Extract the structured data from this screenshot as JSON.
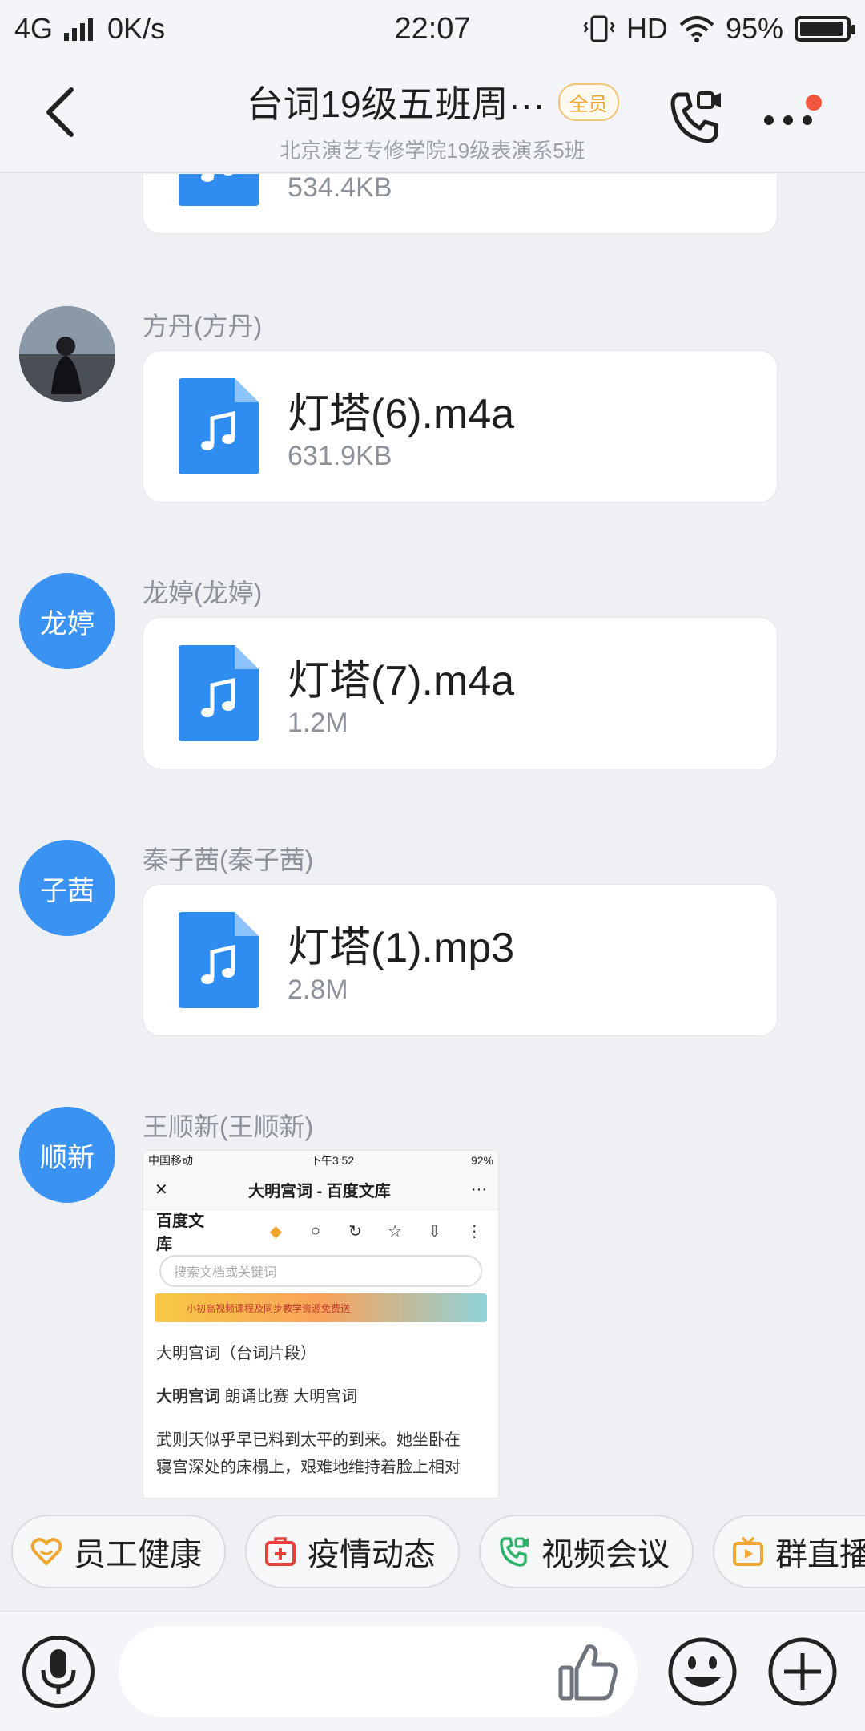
{
  "status_bar": {
    "network": "4G",
    "speed": "0K/s",
    "time": "22:07",
    "hd": "HD",
    "battery_text": "95%",
    "battery_level": 0.95
  },
  "header": {
    "title": "台词19级五班周···",
    "badge": "全员",
    "subtitle": "北京演艺专修学院19级表演系5班"
  },
  "messages": [
    {
      "file_size": "534.4KB"
    },
    {
      "sender": "方丹(方丹)",
      "file_name": "灯塔(6).m4a",
      "file_size": "631.9KB"
    },
    {
      "sender": "龙婷(龙婷)",
      "avatar_text": "龙婷",
      "file_name": "灯塔(7).m4a",
      "file_size": "1.2M"
    },
    {
      "sender": "秦子茜(秦子茜)",
      "avatar_text": "子茜",
      "file_name": "灯塔(1).mp3",
      "file_size": "2.8M"
    },
    {
      "sender": "王顺新(王顺新)",
      "avatar_text": "顺新"
    }
  ],
  "screenshot": {
    "carrier": "中国移动",
    "time": "下午3:52",
    "battery": "92%",
    "title": "大明宫词 - 百度文库",
    "brand": "百度文库",
    "search_placeholder": "搜索文档或关键词",
    "banner": "小初高视频课程及同步教学资源免费送",
    "line1": "大明宫词（台词片段）",
    "line2_bold": "大明宫词",
    "line2_rest": "朗诵比赛 大明宫词",
    "line3": "武则天似乎早已料到太平的到来。她坐卧在",
    "line4": "寝宫深处的床榻上，艰难地维持着脸上相对"
  },
  "quick_actions": [
    {
      "label": "员工健康",
      "icon": "heart-icon",
      "color": "#f0a531"
    },
    {
      "label": "疫情动态",
      "icon": "first-aid-icon",
      "color": "#e8413a"
    },
    {
      "label": "视频会议",
      "icon": "video-call-icon",
      "color": "#2db36a"
    },
    {
      "label": "群直播",
      "icon": "tv-icon",
      "color": "#f0a531"
    }
  ]
}
